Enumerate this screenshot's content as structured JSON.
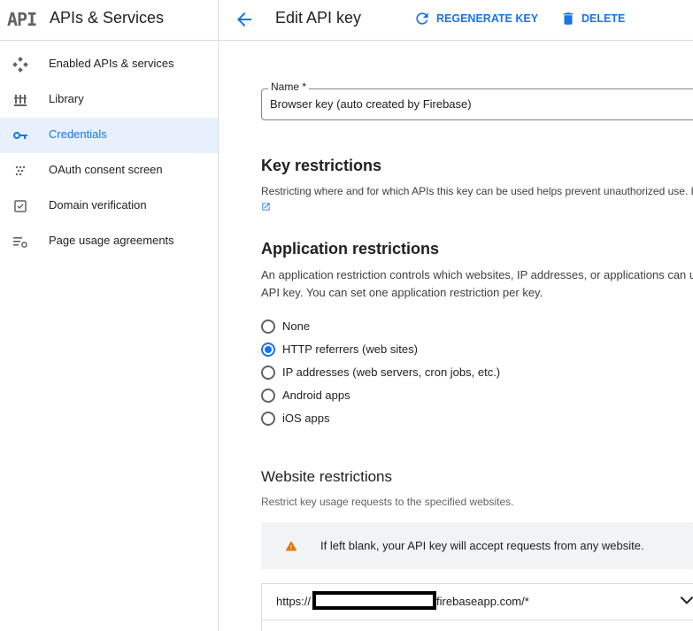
{
  "sidebar": {
    "logo": "API",
    "title": "APIs & Services",
    "items": [
      {
        "label": "Enabled APIs & services",
        "icon": "enabled-apis-icon",
        "active": false
      },
      {
        "label": "Library",
        "icon": "library-icon",
        "active": false
      },
      {
        "label": "Credentials",
        "icon": "key-icon",
        "active": true
      },
      {
        "label": "OAuth consent screen",
        "icon": "oauth-consent-icon",
        "active": false
      },
      {
        "label": "Domain verification",
        "icon": "domain-verification-icon",
        "active": false
      },
      {
        "label": "Page usage agreements",
        "icon": "page-usage-agreements-icon",
        "active": false
      }
    ]
  },
  "header": {
    "title": "Edit API key",
    "regenerate_label": "REGENERATE KEY",
    "delete_label": "DELETE"
  },
  "name_field": {
    "label": "Name *",
    "value": "Browser key (auto created by Firebase)"
  },
  "key_restrictions": {
    "title": "Key restrictions",
    "description": "Restricting where and for which APIs this key can be used helps prevent unauthorized use. L"
  },
  "app_restrictions": {
    "title": "Application restrictions",
    "description_line1": "An application restriction controls which websites, IP addresses, or applications can u",
    "description_line2": "API key. You can set one application restriction per key.",
    "options": [
      {
        "label": "None",
        "checked": false
      },
      {
        "label": "HTTP referrers (web sites)",
        "checked": true
      },
      {
        "label": "IP addresses (web servers, cron jobs, etc.)",
        "checked": false
      },
      {
        "label": "Android apps",
        "checked": false
      },
      {
        "label": "iOS apps",
        "checked": false
      }
    ]
  },
  "website_restrictions": {
    "title": "Website restrictions",
    "description": "Restrict key usage requests to the specified websites.",
    "warning": "If left blank, your API key will accept requests from any website.",
    "items": [
      {
        "prefix": "https://",
        "suffix": "firebaseapp.com/*"
      }
    ]
  },
  "colors": {
    "accent": "#1a73e8",
    "active_bg": "#e8f0fe",
    "warning": "#e37400",
    "text": "#202124",
    "border": "#dadce0"
  }
}
